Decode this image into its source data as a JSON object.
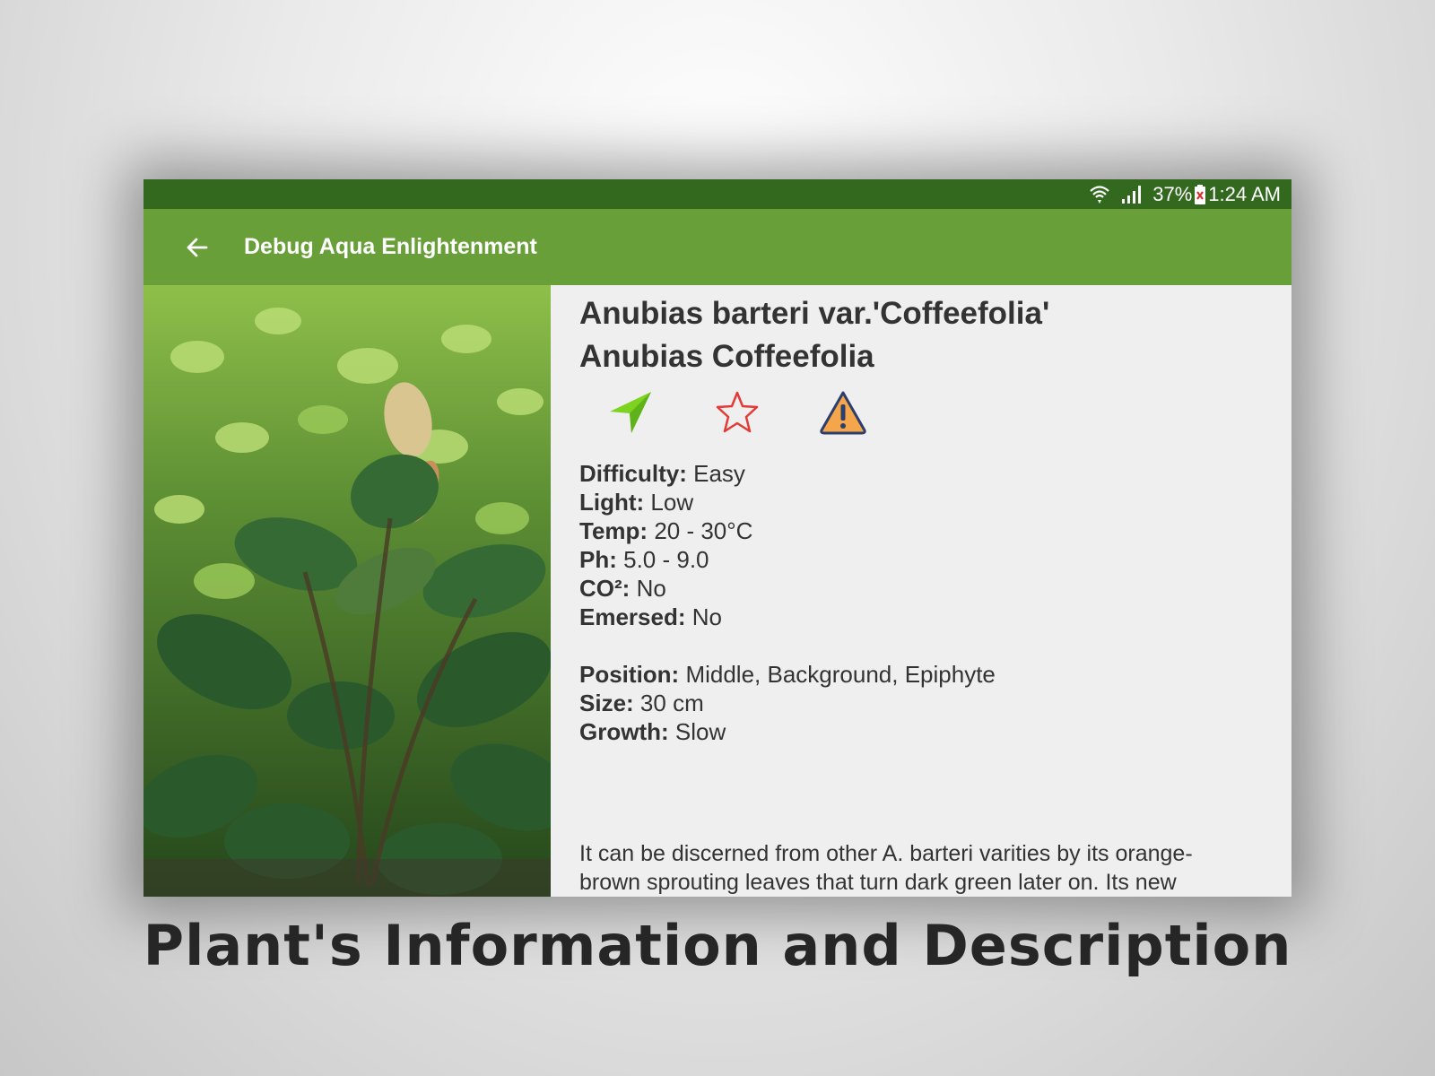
{
  "status_bar": {
    "battery_percent": "37%",
    "time": "1:24 AM"
  },
  "app_bar": {
    "title": "Debug Aqua Enlightenment",
    "back_icon": "arrow-left-icon"
  },
  "plant": {
    "scientific_name": "Anubias barteri var.'Coffeefolia'",
    "common_name": "Anubias Coffeefolia",
    "actions": [
      {
        "name": "send-icon",
        "color": "#7ed321"
      },
      {
        "name": "star-outline-icon",
        "color": "#e53935"
      },
      {
        "name": "warning-icon",
        "color": "#f5a54a"
      }
    ],
    "properties": [
      {
        "label": "Difficulty:",
        "value": "Easy"
      },
      {
        "label": "Light:",
        "value": "Low"
      },
      {
        "label": "Temp:",
        "value": "20 - 30°C"
      },
      {
        "label": "Ph:",
        "value": "5.0 - 9.0"
      },
      {
        "label": "CO²:",
        "value": "No"
      },
      {
        "label": "Emersed:",
        "value": "No"
      }
    ],
    "properties2": [
      {
        "label": "Position:",
        "value": "Middle, Background, Epiphyte"
      },
      {
        "label": "Size:",
        "value": "30 cm"
      },
      {
        "label": "Growth:",
        "value": "Slow"
      }
    ],
    "description": "It can be discerned from other A. barteri varities by its orange-brown sprouting leaves that turn dark green later on. Its new"
  },
  "caption": "Plant's Information and Description",
  "colors": {
    "status_bar": "#33691e",
    "app_bar": "#689f38",
    "content_bg": "#efefef"
  }
}
